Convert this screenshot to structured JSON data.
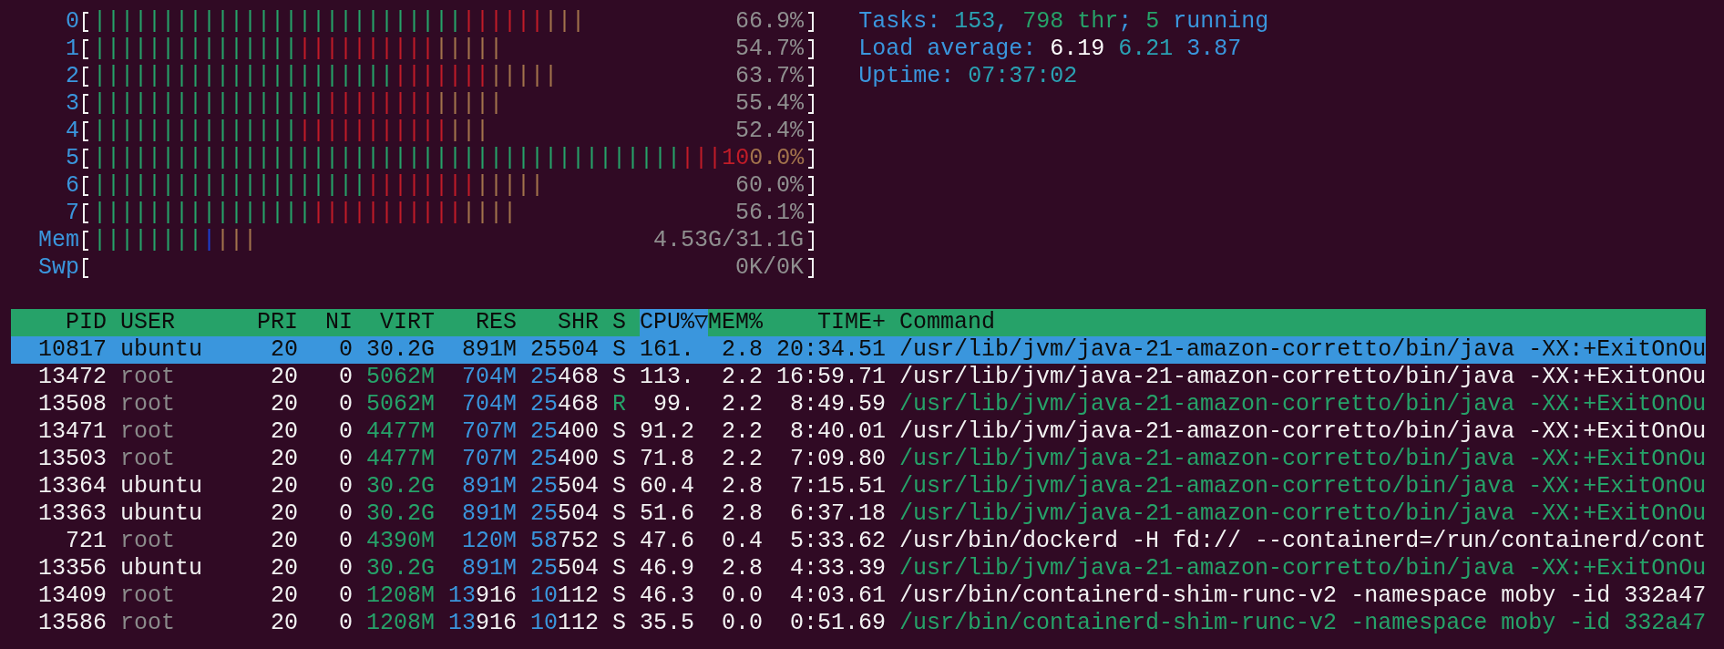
{
  "meters": [
    {
      "label": "0",
      "reading": "66.9%",
      "segments": [
        {
          "color": "#26a269",
          "bar": "|||||||||||||||||||||||||||"
        },
        {
          "color": "#c01c28",
          "bar": "||||||"
        },
        {
          "color": "#a2734c",
          "bar": "|||"
        }
      ]
    },
    {
      "label": "1",
      "reading": "54.7%",
      "segments": [
        {
          "color": "#26a269",
          "bar": "|||||||||||||||"
        },
        {
          "color": "#c01c28",
          "bar": "||||||||||"
        },
        {
          "color": "#a2734c",
          "bar": "|||||"
        }
      ]
    },
    {
      "label": "2",
      "reading": "63.7%",
      "segments": [
        {
          "color": "#26a269",
          "bar": "||||||||||||||||||||||"
        },
        {
          "color": "#c01c28",
          "bar": "|||||||"
        },
        {
          "color": "#a2734c",
          "bar": "|||||"
        }
      ]
    },
    {
      "label": "3",
      "reading": "55.4%",
      "segments": [
        {
          "color": "#26a269",
          "bar": "|||||||||||||||||"
        },
        {
          "color": "#c01c28",
          "bar": "||||||||"
        },
        {
          "color": "#a2734c",
          "bar": "|||||"
        }
      ]
    },
    {
      "label": "4",
      "reading": "52.4%",
      "segments": [
        {
          "color": "#26a269",
          "bar": "|||||||||||||||"
        },
        {
          "color": "#c01c28",
          "bar": "|||||||||||"
        },
        {
          "color": "#a2734c",
          "bar": "|||"
        }
      ]
    },
    {
      "label": "5",
      "reading": [
        {
          "text": "10",
          "color": "#c01c28"
        },
        {
          "text": "0.0%",
          "color": "#a2734c"
        }
      ],
      "segments": [
        {
          "color": "#26a269",
          "bar": "|||||||||||||||||||||||||||||||||||||||||||"
        },
        {
          "color": "#c01c28",
          "bar": "|||"
        }
      ]
    },
    {
      "label": "6",
      "reading": "60.0%",
      "segments": [
        {
          "color": "#26a269",
          "bar": "||||||||||||||||||||"
        },
        {
          "color": "#c01c28",
          "bar": "||||||||"
        },
        {
          "color": "#a2734c",
          "bar": "|||||"
        }
      ]
    },
    {
      "label": "7",
      "reading": "56.1%",
      "segments": [
        {
          "color": "#26a269",
          "bar": "||||||||||||||||"
        },
        {
          "color": "#c01c28",
          "bar": "|||||||||||"
        },
        {
          "color": "#a2734c",
          "bar": "||||"
        }
      ]
    },
    {
      "label": "Mem",
      "reading": "4.53G/31.1G",
      "segments": [
        {
          "color": "#26a269",
          "bar": "||||||||"
        },
        {
          "color": "#1c3fd0",
          "bar": "|"
        },
        {
          "color": "#a2734c",
          "bar": "|||"
        }
      ]
    },
    {
      "label": "Swp",
      "reading": "0K/0K"
    }
  ],
  "summary": [
    [
      {
        "text": "Tasks: ",
        "kind": "label"
      },
      {
        "text": "153",
        "kind": "value"
      },
      {
        "text": ", ",
        "kind": "label"
      },
      {
        "text": "798 thr",
        "kind": "threads"
      },
      {
        "text": "; ",
        "kind": "label"
      },
      {
        "text": "5",
        "kind": "threads"
      },
      {
        "text": " running",
        "kind": "label"
      }
    ],
    [
      {
        "text": "Load average: ",
        "kind": "label"
      },
      {
        "text": "6.19",
        "kind": "load1"
      },
      {
        "text": "6.21",
        "kind": "load5"
      },
      {
        "text": "3.87",
        "kind": "load15"
      }
    ],
    [
      {
        "text": "Uptime: ",
        "kind": "label"
      },
      {
        "text": "07:37:02",
        "kind": "value"
      }
    ]
  ],
  "columns": [
    {
      "label": "PID",
      "selected": false
    },
    {
      "label": "USER",
      "selected": false
    },
    {
      "label": "PRI",
      "selected": false
    },
    {
      "label": "NI",
      "selected": false
    },
    {
      "label": "VIRT",
      "selected": false
    },
    {
      "label": "RES",
      "selected": false
    },
    {
      "label": "SHR",
      "selected": false
    },
    {
      "label": "S",
      "selected": false
    },
    {
      "label": "CPU%▽",
      "selected": true
    },
    {
      "label": "MEM%",
      "selected": false
    },
    {
      "label": "TIME+",
      "selected": false
    },
    {
      "label": "Command",
      "selected": false
    }
  ],
  "rows": [
    {
      "selected": true,
      "cells": [
        "10817",
        "ubuntu",
        "20",
        "0",
        "30.2G",
        "891M",
        "25504",
        "S",
        "161.",
        "2.8",
        "20:34.51",
        "/usr/lib/jvm/java-21-amazon-corretto/bin/java -XX:+ExitOnOu"
      ]
    },
    {
      "selected": false,
      "own_user": false,
      "running": false,
      "thread": false,
      "cells": [
        "13472",
        "root",
        "20",
        "0",
        [
          {
            "text": "5062M",
            "kind": "giga"
          }
        ],
        [
          {
            "text": "704M",
            "kind": "mega"
          }
        ],
        [
          {
            "text": "25",
            "kind": "kilo"
          },
          {
            "text": "468",
            "kind": "unit"
          }
        ],
        "S",
        "113.",
        "2.2",
        "16:59.71",
        "/usr/lib/jvm/java-21-amazon-corretto/bin/java -XX:+ExitOnOu"
      ]
    },
    {
      "selected": false,
      "own_user": false,
      "running": true,
      "thread": true,
      "cells": [
        "13508",
        "root",
        "20",
        "0",
        [
          {
            "text": "5062M",
            "kind": "giga"
          }
        ],
        [
          {
            "text": "704M",
            "kind": "mega"
          }
        ],
        [
          {
            "text": "25",
            "kind": "kilo"
          },
          {
            "text": "468",
            "kind": "unit"
          }
        ],
        "R",
        "99.",
        "2.2",
        "8:49.59",
        "/usr/lib/jvm/java-21-amazon-corretto/bin/java -XX:+ExitOnOu"
      ]
    },
    {
      "selected": false,
      "own_user": false,
      "running": false,
      "thread": false,
      "cells": [
        "13471",
        "root",
        "20",
        "0",
        [
          {
            "text": "4477M",
            "kind": "giga"
          }
        ],
        [
          {
            "text": "707M",
            "kind": "mega"
          }
        ],
        [
          {
            "text": "25",
            "kind": "kilo"
          },
          {
            "text": "400",
            "kind": "unit"
          }
        ],
        "S",
        "91.2",
        "2.2",
        "8:40.01",
        "/usr/lib/jvm/java-21-amazon-corretto/bin/java -XX:+ExitOnOu"
      ]
    },
    {
      "selected": false,
      "own_user": false,
      "running": false,
      "thread": true,
      "cells": [
        "13503",
        "root",
        "20",
        "0",
        [
          {
            "text": "4477M",
            "kind": "giga"
          }
        ],
        [
          {
            "text": "707M",
            "kind": "mega"
          }
        ],
        [
          {
            "text": "25",
            "kind": "kilo"
          },
          {
            "text": "400",
            "kind": "unit"
          }
        ],
        "S",
        "71.8",
        "2.2",
        "7:09.80",
        "/usr/lib/jvm/java-21-amazon-corretto/bin/java -XX:+ExitOnOu"
      ]
    },
    {
      "selected": false,
      "own_user": true,
      "running": false,
      "thread": true,
      "cells": [
        "13364",
        "ubuntu",
        "20",
        "0",
        [
          {
            "text": "30.2G",
            "kind": "giga"
          }
        ],
        [
          {
            "text": "891M",
            "kind": "mega"
          }
        ],
        [
          {
            "text": "25",
            "kind": "kilo"
          },
          {
            "text": "504",
            "kind": "unit"
          }
        ],
        "S",
        "60.4",
        "2.8",
        "7:15.51",
        "/usr/lib/jvm/java-21-amazon-corretto/bin/java -XX:+ExitOnOu"
      ]
    },
    {
      "selected": false,
      "own_user": true,
      "running": false,
      "thread": true,
      "cells": [
        "13363",
        "ubuntu",
        "20",
        "0",
        [
          {
            "text": "30.2G",
            "kind": "giga"
          }
        ],
        [
          {
            "text": "891M",
            "kind": "mega"
          }
        ],
        [
          {
            "text": "25",
            "kind": "kilo"
          },
          {
            "text": "504",
            "kind": "unit"
          }
        ],
        "S",
        "51.6",
        "2.8",
        "6:37.18",
        "/usr/lib/jvm/java-21-amazon-corretto/bin/java -XX:+ExitOnOu"
      ]
    },
    {
      "selected": false,
      "own_user": false,
      "running": false,
      "thread": false,
      "cells": [
        "721",
        "root",
        "20",
        "0",
        [
          {
            "text": "4390M",
            "kind": "giga"
          }
        ],
        [
          {
            "text": "120M",
            "kind": "mega"
          }
        ],
        [
          {
            "text": "58",
            "kind": "kilo"
          },
          {
            "text": "752",
            "kind": "unit"
          }
        ],
        "S",
        "47.6",
        "0.4",
        "5:33.62",
        "/usr/bin/dockerd -H fd:// --containerd=/run/containerd/cont"
      ]
    },
    {
      "selected": false,
      "own_user": true,
      "running": false,
      "thread": true,
      "cells": [
        "13356",
        "ubuntu",
        "20",
        "0",
        [
          {
            "text": "30.2G",
            "kind": "giga"
          }
        ],
        [
          {
            "text": "891M",
            "kind": "mega"
          }
        ],
        [
          {
            "text": "25",
            "kind": "kilo"
          },
          {
            "text": "504",
            "kind": "unit"
          }
        ],
        "S",
        "46.9",
        "2.8",
        "4:33.39",
        "/usr/lib/jvm/java-21-amazon-corretto/bin/java -XX:+ExitOnOu"
      ]
    },
    {
      "selected": false,
      "own_user": false,
      "running": false,
      "thread": false,
      "cells": [
        "13409",
        "root",
        "20",
        "0",
        [
          {
            "text": "1208M",
            "kind": "giga"
          }
        ],
        [
          {
            "text": "13",
            "kind": "kilo"
          },
          {
            "text": "916",
            "kind": "unit"
          }
        ],
        [
          {
            "text": "10",
            "kind": "kilo"
          },
          {
            "text": "112",
            "kind": "unit"
          }
        ],
        "S",
        "46.3",
        "0.0",
        "4:03.61",
        "/usr/bin/containerd-shim-runc-v2 -namespace moby -id 332a47"
      ]
    },
    {
      "selected": false,
      "own_user": false,
      "running": false,
      "thread": true,
      "cells": [
        "13586",
        "root",
        "20",
        "0",
        [
          {
            "text": "1208M",
            "kind": "giga"
          }
        ],
        [
          {
            "text": "13",
            "kind": "kilo"
          },
          {
            "text": "916",
            "kind": "unit"
          }
        ],
        [
          {
            "text": "10",
            "kind": "kilo"
          },
          {
            "text": "112",
            "kind": "unit"
          }
        ],
        "S",
        "35.5",
        "0.0",
        "0:51.69",
        "/usr/bin/containerd-shim-runc-v2 -namespace moby -id 332a47"
      ]
    }
  ]
}
